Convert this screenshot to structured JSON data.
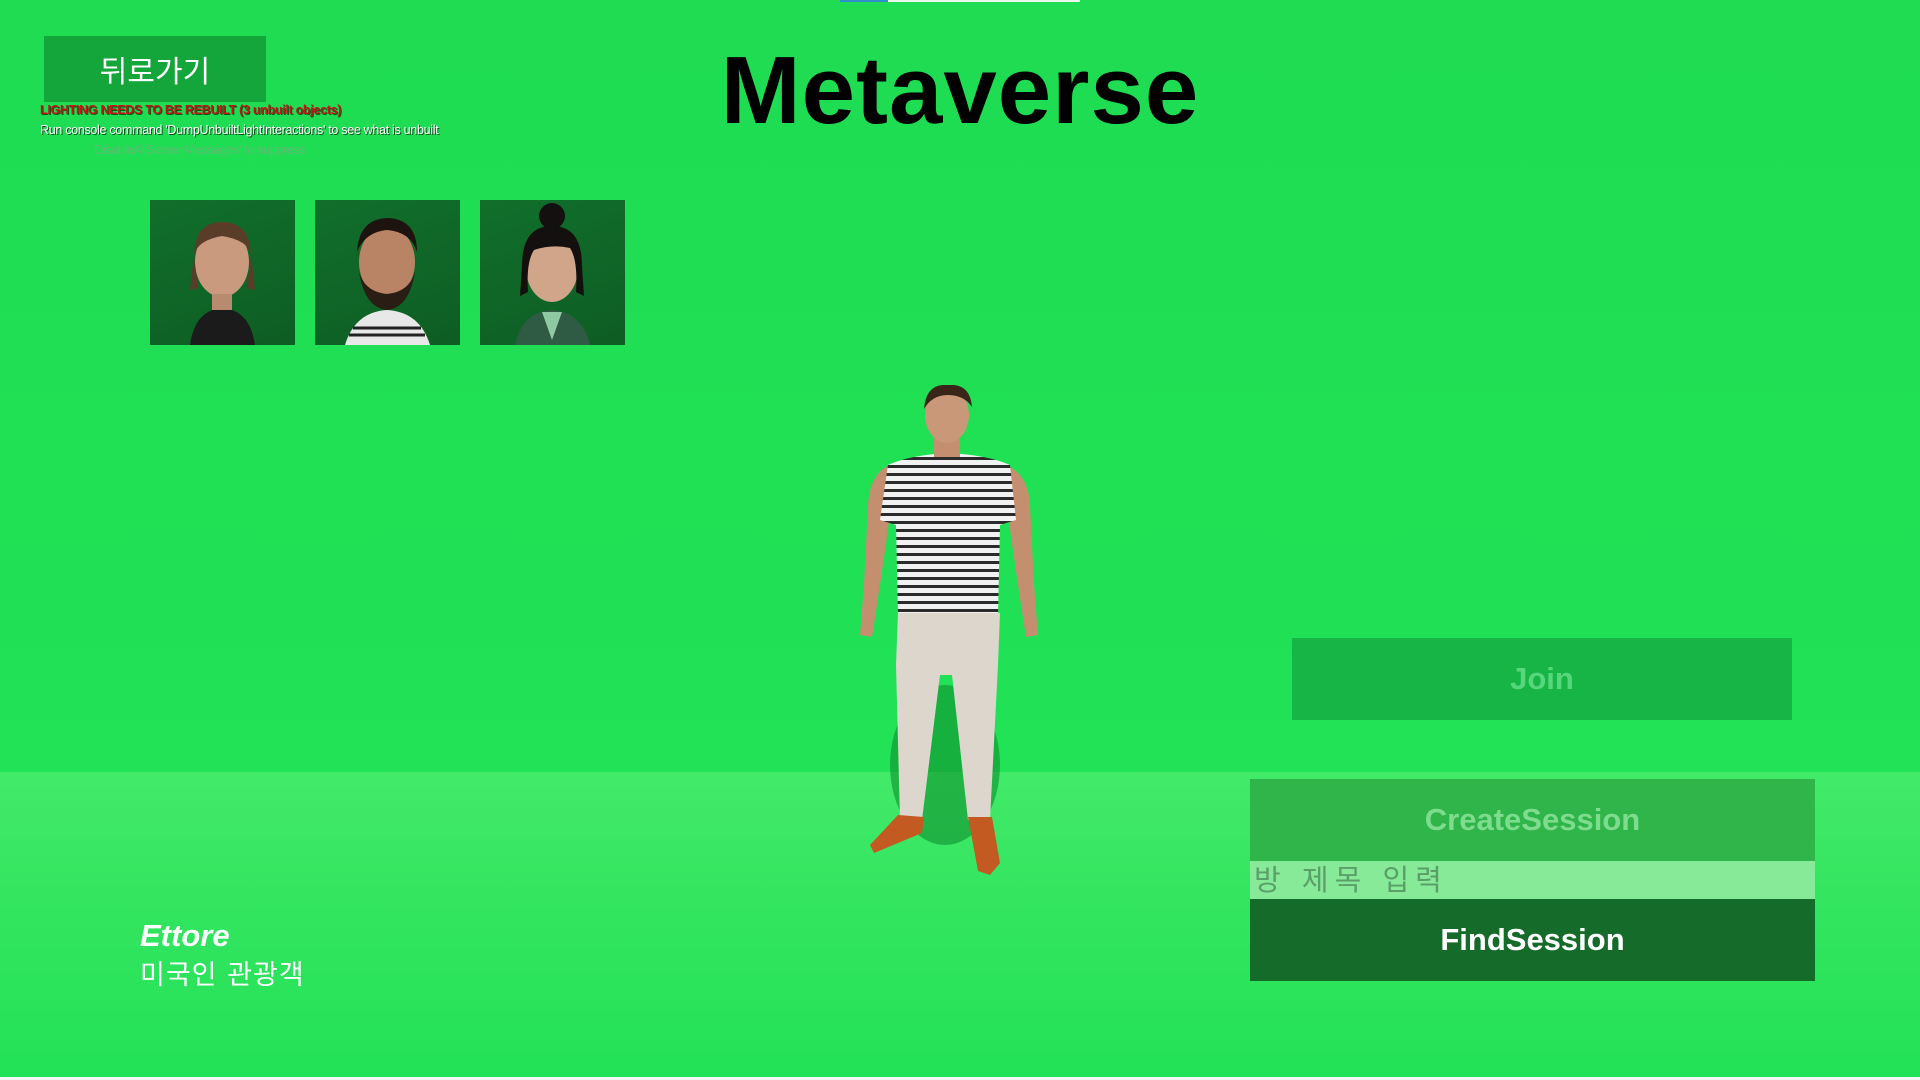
{
  "window": {
    "title": "Metaverse"
  },
  "loading_bar": {
    "progress": 0.2
  },
  "back_button": {
    "label": "뒤로가기"
  },
  "debug_messages": {
    "line1": "LIGHTING NEEDS TO BE REBUILT (3 unbuilt objects)",
    "line2": "Run console command 'DumpUnbuiltLightInteractions' to see what is unbuilt",
    "line3": "'DisableAllScreenMessages' to suppress"
  },
  "portraits": [
    {
      "icon": "character-portrait-1"
    },
    {
      "icon": "character-portrait-2"
    },
    {
      "icon": "character-portrait-3"
    }
  ],
  "session": {
    "join_label": "Join",
    "create_label": "CreateSession",
    "room_title_placeholder": "방 제목 입력",
    "find_label": "FindSession"
  },
  "character": {
    "name": "Ettore",
    "description": "미국인 관광객"
  },
  "colors": {
    "background": "#20e155",
    "floor": "#43ea6a",
    "find_button": "#156b2a",
    "join_button": "#17b546",
    "create_button": "#2fb549",
    "input": "#86ea98"
  }
}
